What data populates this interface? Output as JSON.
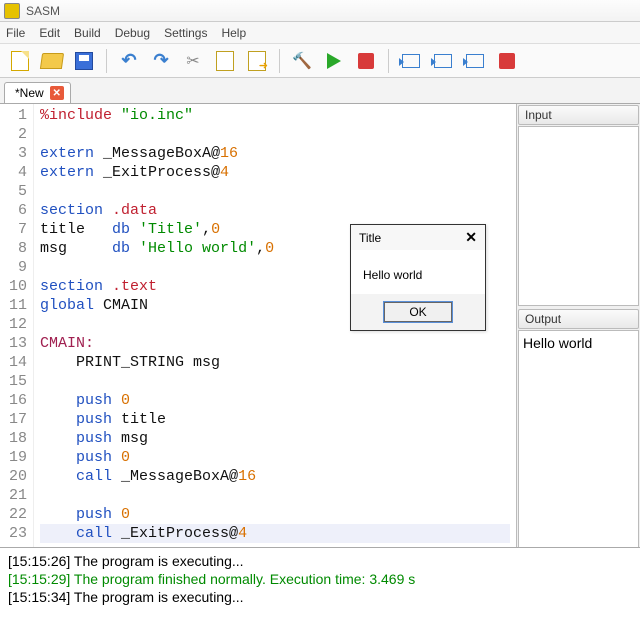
{
  "app": {
    "title": "SASM"
  },
  "menu": {
    "file": "File",
    "edit": "Edit",
    "build": "Build",
    "debug": "Debug",
    "settings": "Settings",
    "help": "Help"
  },
  "tab": {
    "label": "*New"
  },
  "code_lines": [
    {
      "n": "1",
      "html": "<span class='k-red'>%include</span> <span class='k-green'>\"io.inc\"</span>"
    },
    {
      "n": "2",
      "html": ""
    },
    {
      "n": "3",
      "html": "<span class='k-blue'>extern</span> _MessageBoxA@<span class='k-orange'>16</span>"
    },
    {
      "n": "4",
      "html": "<span class='k-blue'>extern</span> _ExitProcess@<span class='k-orange'>4</span>"
    },
    {
      "n": "5",
      "html": ""
    },
    {
      "n": "6",
      "html": "<span class='k-blue'>section</span> <span class='k-red'>.data</span>"
    },
    {
      "n": "7",
      "html": "title   <span class='k-blue'>db</span> <span class='k-green'>'Title'</span>,<span class='k-orange'>0</span>"
    },
    {
      "n": "8",
      "html": "msg     <span class='k-blue'>db</span> <span class='k-green'>'Hello world'</span>,<span class='k-orange'>0</span>"
    },
    {
      "n": "9",
      "html": ""
    },
    {
      "n": "10",
      "html": "<span class='k-blue'>section</span> <span class='k-red'>.text</span>"
    },
    {
      "n": "11",
      "html": "<span class='k-blue'>global</span> CMAIN"
    },
    {
      "n": "12",
      "html": ""
    },
    {
      "n": "13",
      "html": "<span class='k-label'>CMAIN:</span>"
    },
    {
      "n": "14",
      "html": "    PRINT_STRING msg"
    },
    {
      "n": "15",
      "html": ""
    },
    {
      "n": "16",
      "html": "    <span class='k-blue'>push</span> <span class='k-orange'>0</span>"
    },
    {
      "n": "17",
      "html": "    <span class='k-blue'>push</span> title"
    },
    {
      "n": "18",
      "html": "    <span class='k-blue'>push</span> msg"
    },
    {
      "n": "19",
      "html": "    <span class='k-blue'>push</span> <span class='k-orange'>0</span>"
    },
    {
      "n": "20",
      "html": "    <span class='k-blue'>call</span> _MessageBoxA@<span class='k-orange'>16</span>"
    },
    {
      "n": "21",
      "html": ""
    },
    {
      "n": "22",
      "html": "    <span class='k-blue'>push</span> <span class='k-orange'>0</span>"
    },
    {
      "n": "23",
      "html": "    <span class='k-blue'>call</span> _ExitProcess@<span class='k-orange'>4</span>",
      "current": true
    }
  ],
  "panels": {
    "input_label": "Input",
    "input_value": "",
    "output_label": "Output",
    "output_value": "Hello world"
  },
  "msgbox": {
    "title": "Title",
    "body": "Hello world",
    "ok": "OK"
  },
  "log": [
    {
      "text": "[15:15:26] The program is executing...",
      "cls": ""
    },
    {
      "text": "[15:15:29] The program finished normally. Execution time: 3.469 s",
      "cls": "log-green"
    },
    {
      "text": "[15:15:34] The program is executing...",
      "cls": ""
    }
  ]
}
